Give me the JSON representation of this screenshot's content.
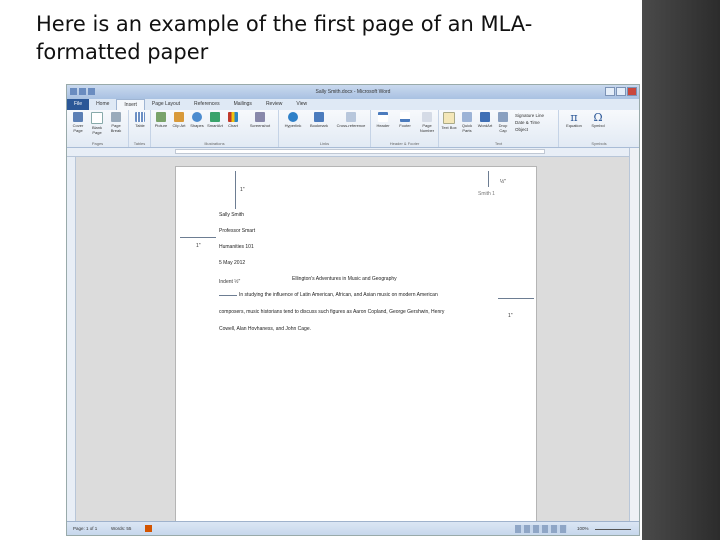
{
  "slide": {
    "title_line1": "Here is an example of the first page of an MLA-",
    "title_line2": "formatted paper"
  },
  "word": {
    "window_title": "Sally Smith.docx - Microsoft Word",
    "tabs": [
      "File",
      "Home",
      "Insert",
      "Page Layout",
      "References",
      "Mailings",
      "Review",
      "View"
    ],
    "active_tab": "Insert",
    "groups": {
      "pages": "Pages",
      "tables": "Tables",
      "illustrations": "Illustrations",
      "links": "Links",
      "header_footer": "Header & Footer",
      "text": "Text",
      "symbols": "Symbols"
    },
    "buttons": {
      "cover_page": "Cover Page",
      "blank_page": "Blank Page",
      "page_break": "Page Break",
      "table": "Table",
      "picture": "Picture",
      "clip_art": "Clip Art",
      "shapes": "Shapes",
      "smartart": "SmartArt",
      "chart": "Chart",
      "screenshot": "Screenshot",
      "hyperlink": "Hyperlink",
      "bookmark": "Bookmark",
      "cross_reference": "Cross-reference",
      "header": "Header",
      "footer": "Footer",
      "page_number": "Page Number",
      "text_box": "Text Box",
      "quick_parts": "Quick Parts",
      "wordart": "WordArt",
      "drop_cap": "Drop Cap",
      "signature_line": "Signature Line",
      "date_time": "Date & Time",
      "object": "Object",
      "equation": "Equation",
      "symbol": "Symbol"
    },
    "status": {
      "page": "Page: 1 of 1",
      "words": "Words: 55",
      "zoom": "100%"
    },
    "colors": {
      "file_tab": "#2b5797",
      "ribbon": "#e2eaf4",
      "statusbar": "#c4d5eb"
    }
  },
  "document": {
    "header": "Smith 1",
    "name": "Sally Smith",
    "professor": "Professor Smart",
    "course": "Humanities 101",
    "date": "5 May 2012",
    "title": "Ellington's Adventures in Music and Geography",
    "indent_label": "Indent ½\"",
    "line1": "In studying the influence of Latin American, African, and Asian music on modern American",
    "line2": "composers, music historians tend to discuss such figures as Aaron Copland, George Gershwin, Henry",
    "line3": "Cowell, Alan Hovhaness, and John Cage.",
    "margin_top": "1\"",
    "margin_header": "½\"",
    "margin_left": "1\"",
    "margin_right": "1\""
  }
}
